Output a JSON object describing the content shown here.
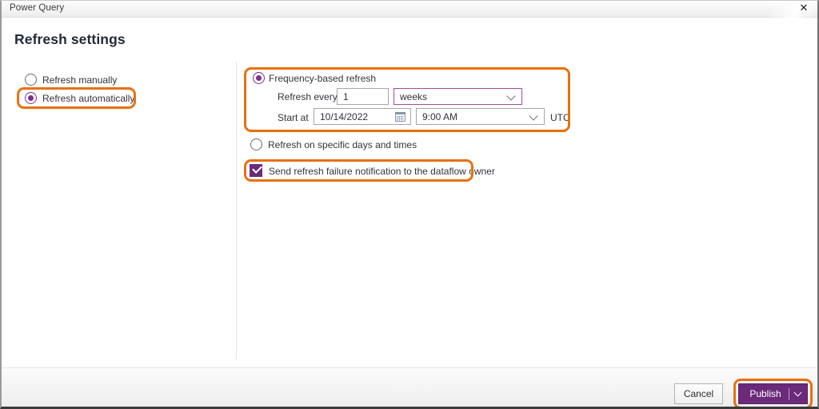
{
  "window": {
    "title": "Power Query",
    "close_icon": "close-icon"
  },
  "page": {
    "heading": "Refresh settings"
  },
  "left_panel": {
    "options": [
      {
        "label": "Refresh manually",
        "selected": false
      },
      {
        "label": "Refresh automatically",
        "selected": true
      }
    ]
  },
  "main": {
    "frequency_option": {
      "label": "Frequency-based refresh",
      "selected": true,
      "refresh_every_label": "Refresh every",
      "interval_value": "1",
      "unit_value": "weeks",
      "start_at_label": "Start at",
      "date_value": "10/14/2022",
      "time_value": "9:00 AM",
      "timezone_label": "UTC",
      "calendar_icon": "calendar-icon",
      "chevron_icon": "chevron-down-icon"
    },
    "specific_days_option": {
      "label": "Refresh on specific days and times",
      "selected": false
    },
    "notification": {
      "label": "Send refresh failure notification to the dataflow owner",
      "checked": true
    }
  },
  "footer": {
    "cancel_label": "Cancel",
    "publish_label": "Publish",
    "publish_dropdown_icon": "chevron-down-icon"
  },
  "colors": {
    "accent_purple": "#6b2a7a",
    "radio_purple": "#7d2f90",
    "highlight_orange": "#e8700f",
    "dropdown_border_purple": "#a04da8"
  }
}
